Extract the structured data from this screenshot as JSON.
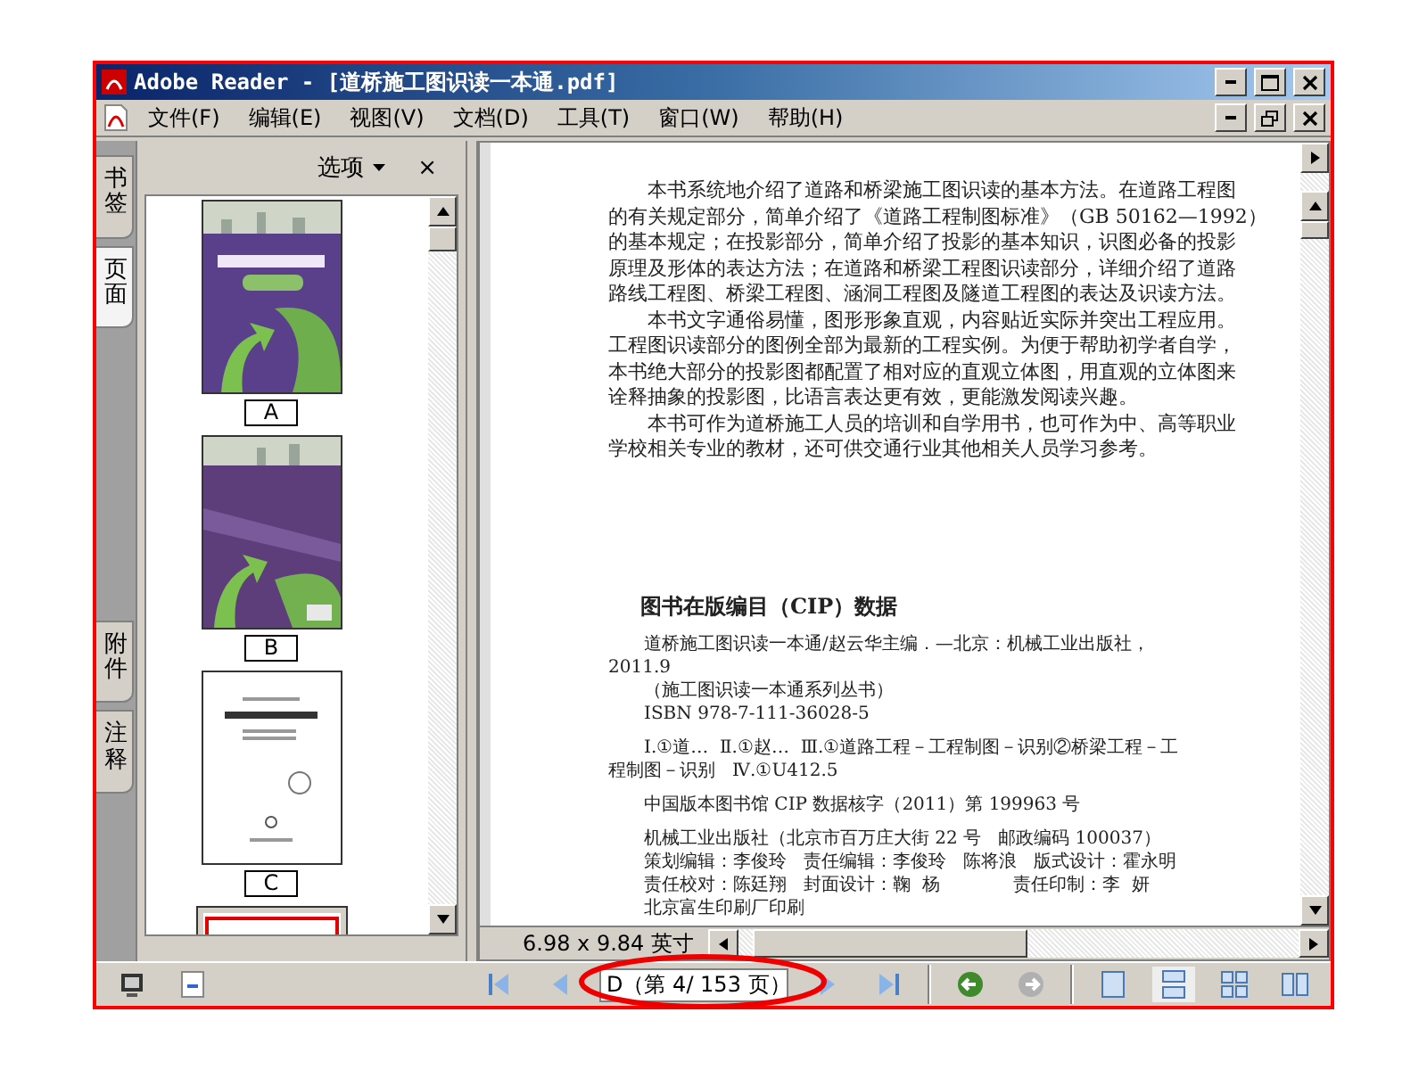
{
  "window": {
    "title": "Adobe Reader - [道桥施工图识读一本通.pdf]"
  },
  "menu": [
    {
      "label": "文件(F)"
    },
    {
      "label": "编辑(E)"
    },
    {
      "label": "视图(V)"
    },
    {
      "label": "文档(D)"
    },
    {
      "label": "工具(T)"
    },
    {
      "label": "窗口(W)"
    },
    {
      "label": "帮助(H)"
    }
  ],
  "side_tabs_top": [
    {
      "label": "书签",
      "selected": false
    },
    {
      "label": "页面",
      "selected": true
    }
  ],
  "side_tabs_bottom": [
    {
      "label": "附件",
      "selected": false
    },
    {
      "label": "注释",
      "selected": false
    }
  ],
  "panel": {
    "options": "选项",
    "close": "×"
  },
  "thumbnails": [
    {
      "label": "A",
      "kind": "cover",
      "selected": false
    },
    {
      "label": "B",
      "kind": "back",
      "selected": false
    },
    {
      "label": "C",
      "kind": "title",
      "selected": false
    },
    {
      "kind": "copyright",
      "selected": true
    }
  ],
  "page": {
    "body_lines": [
      {
        "text": "本书系统地介绍了道路和桥梁施工图识读的基本方法。在道路工程图",
        "indent": true
      },
      {
        "text": "的有关规定部分，简单介绍了《道路工程制图标准》（GB 50162—1992）",
        "indent": false
      },
      {
        "text": "的基本规定；在投影部分，简单介绍了投影的基本知识，识图必备的投影",
        "indent": false
      },
      {
        "text": "原理及形体的表达方法；在道路和桥梁工程图识读部分，详细介绍了道路",
        "indent": false
      },
      {
        "text": "路线工程图、桥梁工程图、涵洞工程图及隧道工程图的表达及识读方法。",
        "indent": false
      },
      {
        "text": "本书文字通俗易懂，图形形象直观，内容贴近实际并突出工程应用。",
        "indent": true
      },
      {
        "text": "工程图识读部分的图例全部为最新的工程实例。为便于帮助初学者自学，",
        "indent": false
      },
      {
        "text": "本书绝大部分的投影图都配置了相对应的直观立体图，用直观的立体图来",
        "indent": false
      },
      {
        "text": "诠释抽象的投影图，比语言表达更有效，更能激发阅读兴趣。",
        "indent": false
      },
      {
        "text": "本书可作为道桥施工人员的培训和自学用书，也可作为中、高等职业",
        "indent": true
      },
      {
        "text": "学校相关专业的教材，还可供交通行业其他相关人员学习参考。",
        "indent": false
      }
    ],
    "cip_title": "图书在版编目（CIP）数据",
    "cip_groups": [
      [
        {
          "text": "道桥施工图识读一本通/赵云华主编．—北京：机械工业出版社，",
          "indent": true
        },
        {
          "text": "2011.9",
          "indent": false
        },
        {
          "text": "（施工图识读一本通系列丛书）",
          "indent": true
        },
        {
          "text": "ISBN 978-7-111-36028-5",
          "indent": true
        }
      ],
      [
        {
          "text": "Ⅰ.①道…  Ⅱ.①赵…  Ⅲ.①道路工程－工程制图－识别②桥梁工程－工",
          "indent": true
        },
        {
          "text": "程制图－识别   Ⅳ.①U412.5",
          "indent": false
        }
      ],
      [
        {
          "text": "中国版本图书馆 CIP 数据核字（2011）第 199963 号",
          "indent": true
        }
      ],
      [
        {
          "text": "机械工业出版社（北京市百万庄大街 22 号   邮政编码 100037）",
          "indent": true
        },
        {
          "text": "策划编辑：李俊玲   责任编辑：李俊玲   陈将浪   版式设计：霍永明",
          "indent": true
        },
        {
          "text": "责任校对：陈廷翔   封面设计：鞠  杨             责任印制：李  妍",
          "indent": true
        },
        {
          "text": "北京富生印刷厂印刷",
          "indent": true
        }
      ]
    ]
  },
  "status": {
    "size": "6.98 x 9.84 英寸"
  },
  "toolbar": {
    "page_field": "D（第 4/ 153 页）"
  },
  "views": [
    {
      "kind": "single",
      "selected": false
    },
    {
      "kind": "continuous",
      "selected": true
    },
    {
      "kind": "facing_continuous",
      "selected": false
    },
    {
      "kind": "facing",
      "selected": false
    }
  ]
}
